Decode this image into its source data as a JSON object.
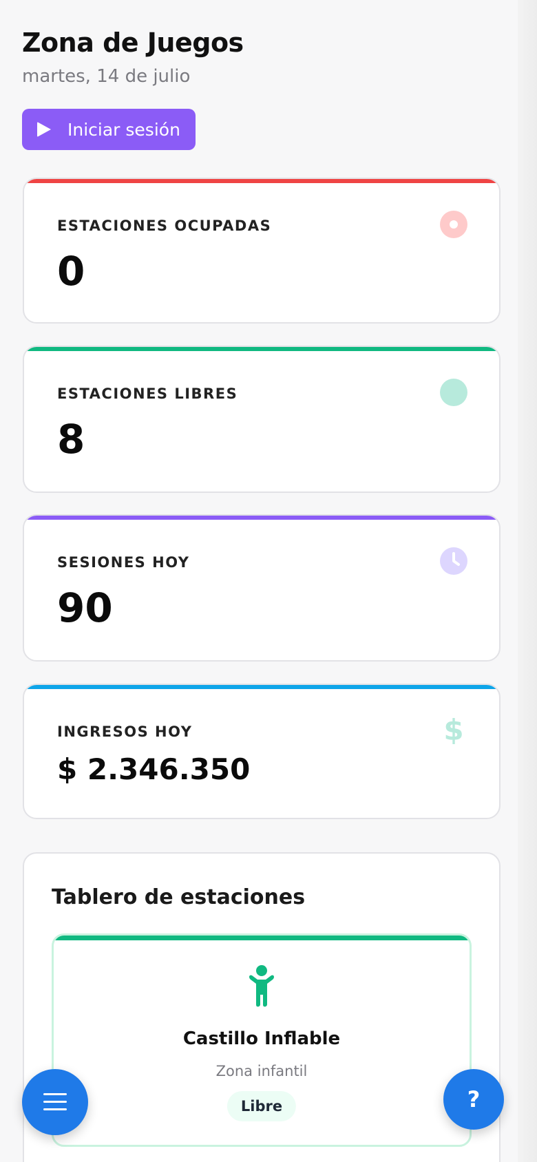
{
  "header": {
    "title": "Zona de Juegos",
    "date": "martes, 14 de julio"
  },
  "actions": {
    "start_session_label": "Iniciar sesión",
    "start_session_icon": "play-icon"
  },
  "stats": [
    {
      "label": "ESTACIONES OCUPADAS",
      "value": "0",
      "accent": "#ef4444",
      "icon": "target-dot-icon",
      "icon_color": "#fecaca"
    },
    {
      "label": "ESTACIONES LIBRES",
      "value": "8",
      "accent": "#10b981",
      "icon": "circle-icon",
      "icon_color": "#b7eadc"
    },
    {
      "label": "SESIONES HOY",
      "value": "90",
      "accent": "#8b5cf6",
      "icon": "clock-icon",
      "icon_color": "#ddd6fe"
    },
    {
      "label": "INGRESOS HOY",
      "value": "$ 2.346.350",
      "accent": "#0ea5e9",
      "icon": "dollar-icon",
      "icon_color": "#b7eadc"
    }
  ],
  "board": {
    "title": "Tablero de estaciones",
    "stations": [
      {
        "name": "Castillo Inflable",
        "zone": "Zona infantil",
        "status": "Libre",
        "accent": "#10b981",
        "icon": "child-icon"
      }
    ]
  },
  "fabs": {
    "menu_icon": "hamburger-menu-icon",
    "help_label": "?"
  },
  "colors": {
    "primary": "#8b5cf6",
    "fab": "#1f7ae8",
    "background": "#f7f7f8"
  }
}
